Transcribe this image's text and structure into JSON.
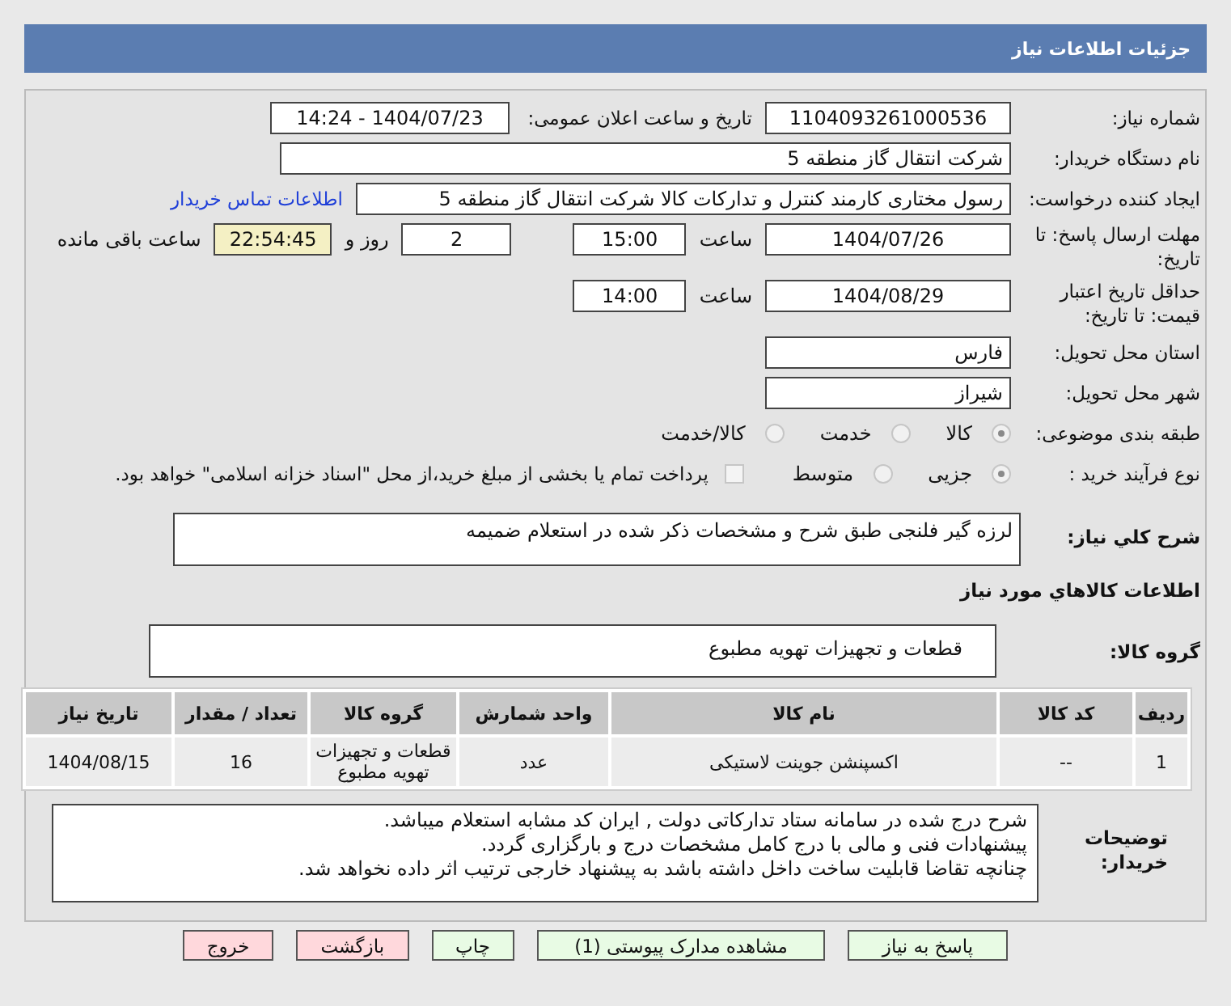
{
  "header": {
    "title": "جزئیات اطلاعات نیاز"
  },
  "need_number": {
    "label": "شماره نیاز:",
    "value": "1104093261000536"
  },
  "announce": {
    "label": "تاریخ و ساعت اعلان عمومی:",
    "value": "1404/07/23 - 14:24"
  },
  "buyer_org": {
    "label": "نام دستگاه خریدار:",
    "value": "شرکت انتقال گاز منطقه 5"
  },
  "requester": {
    "label": "ایجاد کننده درخواست:",
    "value": "رسول  مختاری کارمند کنترل و تدارکات کالا شرکت انتقال گاز منطقه 5",
    "link": "اطلاعات تماس خریدار"
  },
  "deadline": {
    "label": "مهلت ارسال پاسخ: تا تاریخ:",
    "date": "1404/07/26",
    "time_label": "ساعت",
    "time": "15:00",
    "days": "2",
    "days_label": "روز و",
    "remaining": "22:54:45",
    "remaining_label": "ساعت باقی مانده"
  },
  "validity": {
    "label": "حداقل تاریخ اعتبار قیمت: تا تاریخ:",
    "date": "1404/08/29",
    "time_label": "ساعت",
    "time": "14:00"
  },
  "province": {
    "label": "استان محل تحویل:",
    "value": "فارس"
  },
  "city": {
    "label": "شهر محل تحویل:",
    "value": "شیراز"
  },
  "category": {
    "label": "طبقه بندی موضوعی:",
    "options": [
      {
        "label": "کالا",
        "selected": true
      },
      {
        "label": "خدمت",
        "selected": false
      },
      {
        "label": "کالا/خدمت",
        "selected": false
      }
    ]
  },
  "purchase_type": {
    "label": "نوع فرآیند خرید :",
    "options": [
      {
        "label": "جزیی",
        "selected": true
      },
      {
        "label": "متوسط",
        "selected": false
      }
    ],
    "payment": {
      "checked": false,
      "text": "پرداخت تمام یا بخشی از مبلغ خرید،از محل \"اسناد خزانه اسلامی\" خواهد بود."
    }
  },
  "description": {
    "label": "شرح كلي نياز:",
    "value": "لرزه گیر فلنجی طبق شرح و مشخصات ذکر شده در استعلام ضمیمه"
  },
  "goods_heading": "اطلاعات كالاهاي مورد نياز",
  "goods_group": {
    "label": "گروه کالا:",
    "value": "قطعات و تجهیزات تهویه مطبوع"
  },
  "table": {
    "columns": [
      "ردیف",
      "کد کالا",
      "نام کالا",
      "واحد شمارش",
      "گروه کالا",
      "تعداد / مقدار",
      "تاریخ نیاز"
    ],
    "rows": [
      [
        "1",
        "--",
        "اکسپنشن جوینت لاستیکی",
        "عدد",
        "قطعات و تجهیزات تهویه مطبوع",
        "16",
        "1404/08/15"
      ]
    ]
  },
  "buyer_notes": {
    "label": "توضیحات خریدار:",
    "lines": [
      "شرح درج شده در سامانه ستاد تدارکاتی دولت , ایران کد مشابه استعلام میباشد.",
      "پیشنهادات  فنی و مالی با درج کامل مشخصات درج و بارگزاری گردد.",
      "چنانچه تقاضا قابلیت  ساخت داخل داشته باشد به پیشنهاد خارجی ترتیب اثر داده نخواهد شد."
    ]
  },
  "buttons": [
    {
      "label": "پاسخ به نیاز",
      "kind": "green"
    },
    {
      "label": "مشاهده مدارک پیوستی (1)",
      "kind": "green"
    },
    {
      "label": "چاپ",
      "kind": "green"
    },
    {
      "label": "بازگشت",
      "kind": "red"
    },
    {
      "label": "خروج",
      "kind": "red"
    }
  ]
}
